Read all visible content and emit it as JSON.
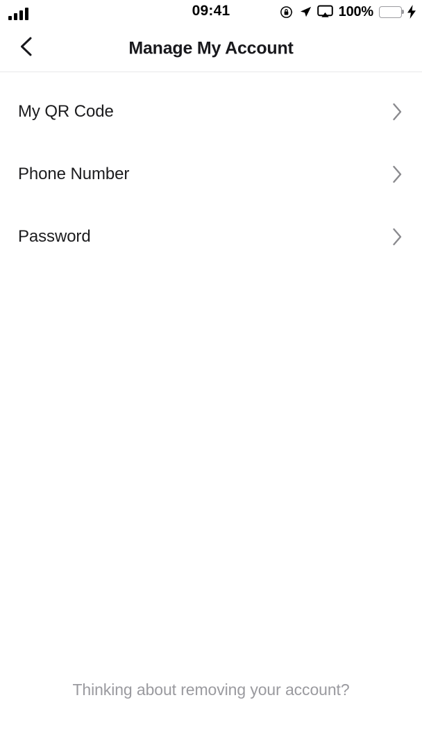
{
  "status_bar": {
    "signal_icon": "cellular-signal-icon",
    "signal_bars_filled": 4,
    "signal_bars_total": 4,
    "time": "09:41",
    "rotation_lock_icon": "rotation-lock-icon",
    "location_icon": "location-arrow-icon",
    "airplay_icon": "airplay-screen-icon",
    "battery_percent": "100%",
    "battery_level": 100,
    "battery_color": "#4cd964",
    "charging_icon": "lightning-bolt-icon"
  },
  "nav": {
    "back_icon": "chevron-left-icon",
    "title": "Manage My Account"
  },
  "list": {
    "items": [
      {
        "label": "My QR Code",
        "chevron": "chevron-right-icon"
      },
      {
        "label": "Phone Number",
        "chevron": "chevron-right-icon"
      },
      {
        "label": "Password",
        "chevron": "chevron-right-icon"
      }
    ]
  },
  "footer": {
    "text": "Thinking about removing your account?",
    "color": "#9a9a9f"
  }
}
